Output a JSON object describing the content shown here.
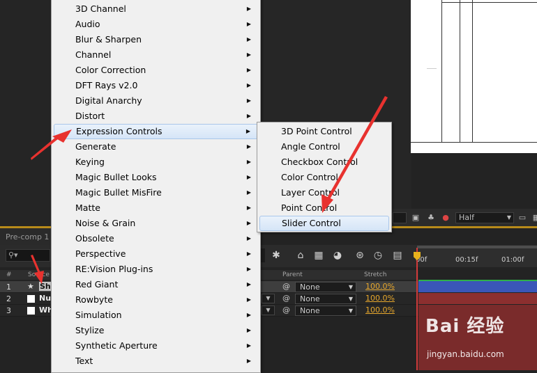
{
  "menu": {
    "items": [
      {
        "label": "3D Channel",
        "submenu": true
      },
      {
        "label": "Audio",
        "submenu": true
      },
      {
        "label": "Blur & Sharpen",
        "submenu": true
      },
      {
        "label": "Channel",
        "submenu": true
      },
      {
        "label": "Color Correction",
        "submenu": true
      },
      {
        "label": "DFT Rays v2.0",
        "submenu": true
      },
      {
        "label": "Digital Anarchy",
        "submenu": true
      },
      {
        "label": "Distort",
        "submenu": true
      },
      {
        "label": "Expression Controls",
        "submenu": true,
        "highlighted": true
      },
      {
        "label": "Generate",
        "submenu": true
      },
      {
        "label": "Keying",
        "submenu": true
      },
      {
        "label": "Magic Bullet Looks",
        "submenu": true
      },
      {
        "label": "Magic Bullet MisFire",
        "submenu": true
      },
      {
        "label": "Matte",
        "submenu": true
      },
      {
        "label": "Noise & Grain",
        "submenu": true
      },
      {
        "label": "Obsolete",
        "submenu": true
      },
      {
        "label": "Perspective",
        "submenu": true
      },
      {
        "label": "RE:Vision Plug-ins",
        "submenu": true
      },
      {
        "label": "Red Giant",
        "submenu": true
      },
      {
        "label": "Rowbyte",
        "submenu": true
      },
      {
        "label": "Simulation",
        "submenu": true
      },
      {
        "label": "Stylize",
        "submenu": true
      },
      {
        "label": "Synthetic Aperture",
        "submenu": true
      },
      {
        "label": "Text",
        "submenu": true
      }
    ],
    "submenu_arrow": "▶"
  },
  "submenu": {
    "items": [
      {
        "label": "3D Point Control"
      },
      {
        "label": "Angle Control"
      },
      {
        "label": "Checkbox Control"
      },
      {
        "label": "Color Control"
      },
      {
        "label": "Layer Control"
      },
      {
        "label": "Point Control"
      },
      {
        "label": "Slider Control",
        "highlighted": true
      }
    ]
  },
  "viewer": {
    "resolution": "Half",
    "dropdown_glyph": "▼"
  },
  "timeline": {
    "tab_label": "Pre-comp 1",
    "search_placeholder": "⚲▾",
    "ruler_labels": [
      "00f",
      "00:15f",
      "01:00f"
    ],
    "columns": {
      "num": "#",
      "source": "Source",
      "parent": "Parent",
      "stretch": "Stretch"
    },
    "layers": [
      {
        "num": "1",
        "name": "Sha",
        "kind": "shape",
        "parent": "None",
        "stretch": "100.0%",
        "selected": true,
        "bar_color": "#3a56b8"
      },
      {
        "num": "2",
        "name": "Nu",
        "kind": "solid",
        "parent": "None",
        "stretch": "100.0%",
        "selected": false,
        "bar_color": "#8c2f2f"
      },
      {
        "num": "3",
        "name": "Wh",
        "kind": "solid",
        "parent": "None",
        "stretch": "100.0%",
        "selected": false,
        "bar_color": "#8c2f2f"
      }
    ]
  },
  "watermark": {
    "logo_text": "Bai 经验",
    "url": "jingyan.baidu.com"
  },
  "colors": {
    "menu_bg": "#f0f0f0",
    "highlight_border": "#a9c6ea",
    "annotation_arrow": "#e8322f",
    "stretch_text": "#e8a82c",
    "playhead": "#d23a3a"
  }
}
